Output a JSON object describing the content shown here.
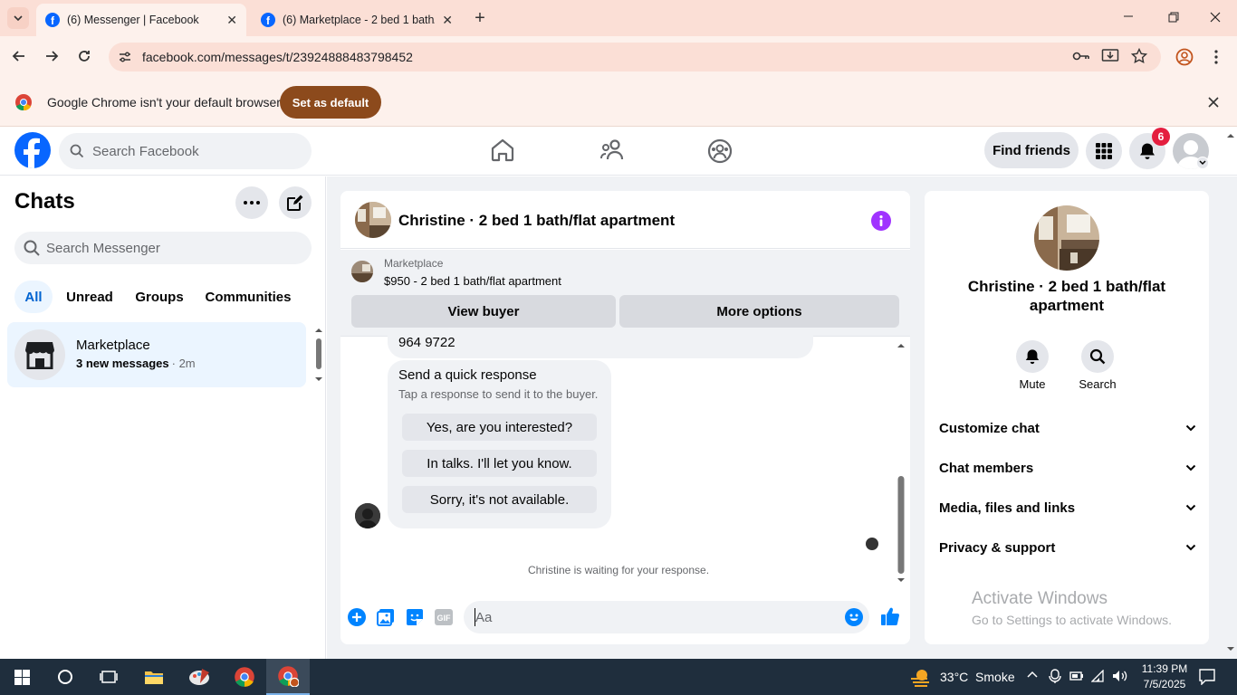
{
  "browser": {
    "tabs": [
      {
        "title": "(6) Messenger | Facebook",
        "active": true
      },
      {
        "title": "(6) Marketplace - 2 bed 1 bath/",
        "active": false
      }
    ],
    "url": "facebook.com/messages/t/23924888483798452",
    "infobar_text": "Google Chrome isn't your default browser",
    "set_default_label": "Set as default"
  },
  "facebook": {
    "search_placeholder": "Search Facebook",
    "find_friends": "Find friends",
    "notif_count": "6"
  },
  "chats": {
    "title": "Chats",
    "search_placeholder": "Search Messenger",
    "filters": [
      "All",
      "Unread",
      "Groups",
      "Communities"
    ],
    "items": [
      {
        "name": "Marketplace",
        "preview": "3 new messages",
        "time": "· 2m"
      }
    ]
  },
  "conversation": {
    "title": "Christine · 2 bed 1 bath/flat apartment",
    "marketplace_label": "Marketplace",
    "listing": "$950 - 2 bed 1 bath/flat apartment",
    "view_buyer": "View buyer",
    "more_options": "More options",
    "partial_message": "964 9722",
    "quick_title": "Send a quick response",
    "quick_sub": "Tap a response to send it to the buyer.",
    "quick_replies": [
      "Yes, are you interested?",
      "In talks. I'll let you know.",
      "Sorry, it's not available."
    ],
    "waiting": "Christine is waiting for your response.",
    "composer_placeholder": "Aa"
  },
  "details": {
    "name": "Christine · 2 bed 1 bath/flat apartment",
    "mute": "Mute",
    "search": "Search",
    "sections": [
      "Customize chat",
      "Chat members",
      "Media, files and links",
      "Privacy & support"
    ]
  },
  "watermark": {
    "title": "Activate Windows",
    "sub": "Go to Settings to activate Windows."
  },
  "taskbar": {
    "weather": "33°C  Smoke",
    "time": "11:39 PM",
    "date": "7/5/2025"
  },
  "colors": {
    "fb_blue": "#0866ff",
    "messenger_accent": "#0084ff",
    "info_purple": "#a033ff"
  }
}
